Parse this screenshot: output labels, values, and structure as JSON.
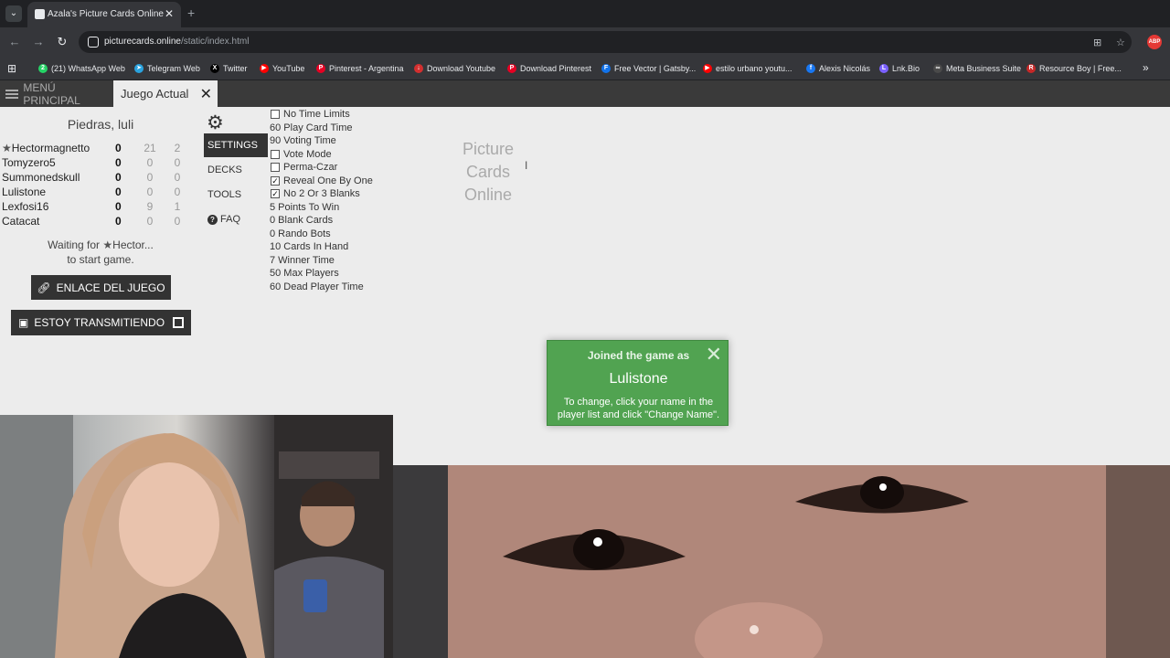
{
  "browser": {
    "tab_title": "Azala's Picture Cards Online",
    "url_host": "picturecards.online",
    "url_path": "/static/index.html",
    "ext_badge": "ABP",
    "bookmarks": [
      {
        "label": "(21) WhatsApp Web",
        "icon": "whatsapp-icon",
        "color": "#25d366",
        "glyph": "2"
      },
      {
        "label": "Telegram Web",
        "icon": "telegram-icon",
        "color": "#2aa3df",
        "glyph": "➤"
      },
      {
        "label": "Twitter",
        "icon": "x-icon",
        "color": "#000000",
        "glyph": "X"
      },
      {
        "label": "YouTube",
        "icon": "youtube-icon",
        "color": "#ff0000",
        "glyph": "▶"
      },
      {
        "label": "Pinterest - Argentina",
        "icon": "pinterest-icon",
        "color": "#e60023",
        "glyph": "P"
      },
      {
        "label": "Download Youtube",
        "icon": "download-icon",
        "color": "#d32f2f",
        "glyph": "↓"
      },
      {
        "label": "Download Pinterest",
        "icon": "pinterest-icon",
        "color": "#e60023",
        "glyph": "P"
      },
      {
        "label": "Free Vector | Gatsby...",
        "icon": "freepik-icon",
        "color": "#1273eb",
        "glyph": "F"
      },
      {
        "label": "estilo urbano youtu...",
        "icon": "youtube-icon",
        "color": "#ff0000",
        "glyph": "▶"
      },
      {
        "label": "Alexis Nicolás",
        "icon": "facebook-icon",
        "color": "#1877f2",
        "glyph": "f"
      },
      {
        "label": "Lnk.Bio",
        "icon": "lnkbio-icon",
        "color": "#7b61ff",
        "glyph": "L"
      },
      {
        "label": "Meta Business Suite",
        "icon": "meta-icon",
        "color": "#4a4a4a",
        "glyph": "∞"
      },
      {
        "label": "Resource Boy | Free...",
        "icon": "resourceboy-icon",
        "color": "#c62828",
        "glyph": "R"
      }
    ]
  },
  "gamebar": {
    "menu_label": "MENÚ PRINCIPAL",
    "current_tab": "Juego Actual"
  },
  "room_title": "Piedras, luli",
  "players": [
    {
      "name": "Hectormagnetto",
      "host": true,
      "score": "0",
      "a": "21",
      "b": "2"
    },
    {
      "name": "Tomyzero5",
      "host": false,
      "score": "0",
      "a": "0",
      "b": "0"
    },
    {
      "name": "Summonedskull",
      "host": false,
      "score": "0",
      "a": "0",
      "b": "0"
    },
    {
      "name": "Lulistone",
      "host": false,
      "score": "0",
      "a": "0",
      "b": "0"
    },
    {
      "name": "Lexfosi16",
      "host": false,
      "score": "0",
      "a": "9",
      "b": "1"
    },
    {
      "name": "Catacat",
      "host": false,
      "score": "0",
      "a": "0",
      "b": "0"
    }
  ],
  "waiting_prefix": "Waiting for ",
  "waiting_name": "Hector...",
  "waiting_suffix": "to start game.",
  "link_button": "ENLACE DEL JUEGO",
  "stream_button": "ESTOY TRANSMITIENDO",
  "side_menu": {
    "settings": "SETTINGS",
    "decks": "DECKS",
    "tools": "TOOLS",
    "faq": "FAQ"
  },
  "settings": [
    {
      "label": "No Time Limits",
      "checkbox": true,
      "checked": false
    },
    {
      "label": "60 Play Card Time",
      "checkbox": false
    },
    {
      "label": "90 Voting Time",
      "checkbox": false
    },
    {
      "label": "Vote Mode",
      "checkbox": true,
      "checked": false
    },
    {
      "label": "Perma-Czar",
      "checkbox": true,
      "checked": false
    },
    {
      "label": "Reveal One By One",
      "checkbox": true,
      "checked": true
    },
    {
      "label": "No 2 Or 3 Blanks",
      "checkbox": true,
      "checked": true
    },
    {
      "label": "5 Points To Win",
      "checkbox": false
    },
    {
      "label": "0 Blank Cards",
      "checkbox": false
    },
    {
      "label": "0 Rando Bots",
      "checkbox": false
    },
    {
      "label": "10 Cards In Hand",
      "checkbox": false
    },
    {
      "label": "7 Winner Time",
      "checkbox": false
    },
    {
      "label": "50 Max Players",
      "checkbox": false
    },
    {
      "label": "60 Dead Player Time",
      "checkbox": false
    }
  ],
  "logo": [
    "Picture",
    "Cards",
    "Online"
  ],
  "toast": {
    "heading": "Joined the game as",
    "name": "Lulistone",
    "body": "To change, click your name in the player list and click \"Change Name\"."
  },
  "colors": {
    "toast_bg": "#51a351",
    "dark_button": "#333333",
    "page_bg": "#ececec"
  }
}
